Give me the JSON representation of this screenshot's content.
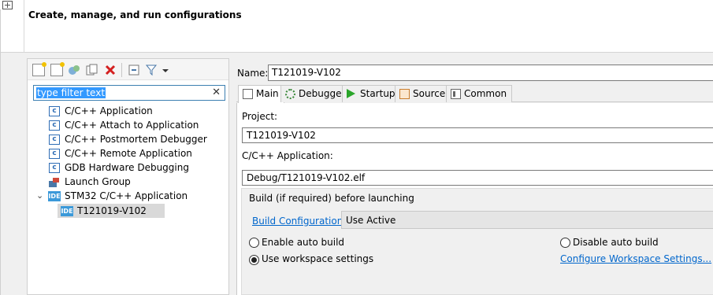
{
  "header": {
    "title": "Create, manage, and run configurations"
  },
  "filter": {
    "value": "type filter text",
    "clear_glyph": "✕"
  },
  "tree": {
    "items": [
      {
        "label": "C/C++ Application",
        "icon": "c-app-icon"
      },
      {
        "label": "C/C++ Attach to Application",
        "icon": "c-app-icon"
      },
      {
        "label": "C/C++ Postmortem Debugger",
        "icon": "c-app-icon"
      },
      {
        "label": "C/C++ Remote Application",
        "icon": "c-app-icon"
      },
      {
        "label": "GDB Hardware Debugging",
        "icon": "c-app-icon"
      },
      {
        "label": "Launch Group",
        "icon": "launch-group-icon"
      },
      {
        "label": "STM32 C/C++ Application",
        "icon": "ide-icon",
        "expanded": true
      },
      {
        "label": "T121019-V102",
        "icon": "ide-icon",
        "selected": true
      }
    ],
    "c_icon_glyph": "c",
    "ide_icon_glyph": "IDE",
    "expand_glyph": "⌄"
  },
  "name": {
    "label": "Name:",
    "value": "T121019-V102"
  },
  "tabs": [
    {
      "label": "Main",
      "active": true,
      "icon": "main-tab-icon"
    },
    {
      "label": "Debugger",
      "icon": "debugger-tab-icon"
    },
    {
      "label": "Startup",
      "icon": "startup-tab-icon"
    },
    {
      "label": "Source",
      "icon": "source-tab-icon"
    },
    {
      "label": "Common",
      "icon": "common-tab-icon"
    }
  ],
  "main": {
    "project_label": "Project:",
    "project_value": "T121019-V102",
    "app_label": "C/C++ Application:",
    "app_value": "Debug/T121019-V102.elf",
    "build": {
      "title": "Build (if required) before launching",
      "config_link": "Build Configuration:",
      "config_value": "Use Active",
      "enable_auto": "Enable auto build",
      "disable_auto": "Disable auto build",
      "use_workspace": "Use workspace settings",
      "configure_link": "Configure Workspace Settings...",
      "selected": "use_workspace"
    }
  },
  "colors": {
    "link": "#0066cc",
    "selection": "#3399ff",
    "ide_blue": "#3b99d9"
  }
}
